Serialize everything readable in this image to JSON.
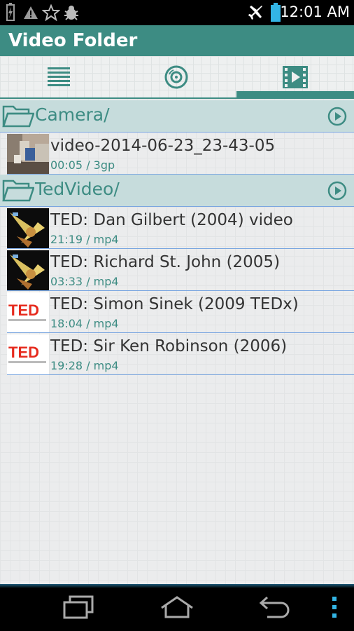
{
  "status_bar": {
    "time": "12:01 AM",
    "icons": [
      "battery-charging-icon",
      "warning-icon",
      "star-icon",
      "bug-icon",
      "airplane-mode-icon",
      "battery-icon"
    ]
  },
  "header": {
    "title": "Video Folder"
  },
  "tabs": [
    {
      "name": "list-view",
      "icon": "list-icon",
      "selected": false
    },
    {
      "name": "disc-view",
      "icon": "disc-icon",
      "selected": false
    },
    {
      "name": "folder-view",
      "icon": "film-icon",
      "selected": true
    }
  ],
  "colors": {
    "accent": "#3d8c83",
    "folder_bg": "#c6dcdc",
    "divider": "#7aa6e0"
  },
  "folders": [
    {
      "name": "Camera/",
      "videos": [
        {
          "title": "video-2014-06-23_23-43-05",
          "meta": "00:05 / 3gp",
          "thumb": "camera-photo"
        }
      ]
    },
    {
      "name": "TedVideo/",
      "videos": [
        {
          "title": "TED: Dan Gilbert (2004) video",
          "meta": "21:19 / mp4",
          "thumb": "ted-talk-frame"
        },
        {
          "title": "TED: Richard St. John (2005)",
          "meta": "03:33 / mp4",
          "thumb": "ted-talk-frame"
        },
        {
          "title": "TED: Simon Sinek (2009 TEDx)",
          "meta": "18:04 / mp4",
          "thumb": "ted-logo"
        },
        {
          "title": "TED: Sir Ken Robinson (2006)",
          "meta": "19:28 / mp4",
          "thumb": "ted-logo"
        }
      ]
    }
  ],
  "ted_logo": {
    "text": "TED",
    "tagline": "ideas worth spreading"
  },
  "nav": [
    "recent-apps-icon",
    "home-icon",
    "back-icon",
    "menu-icon"
  ]
}
